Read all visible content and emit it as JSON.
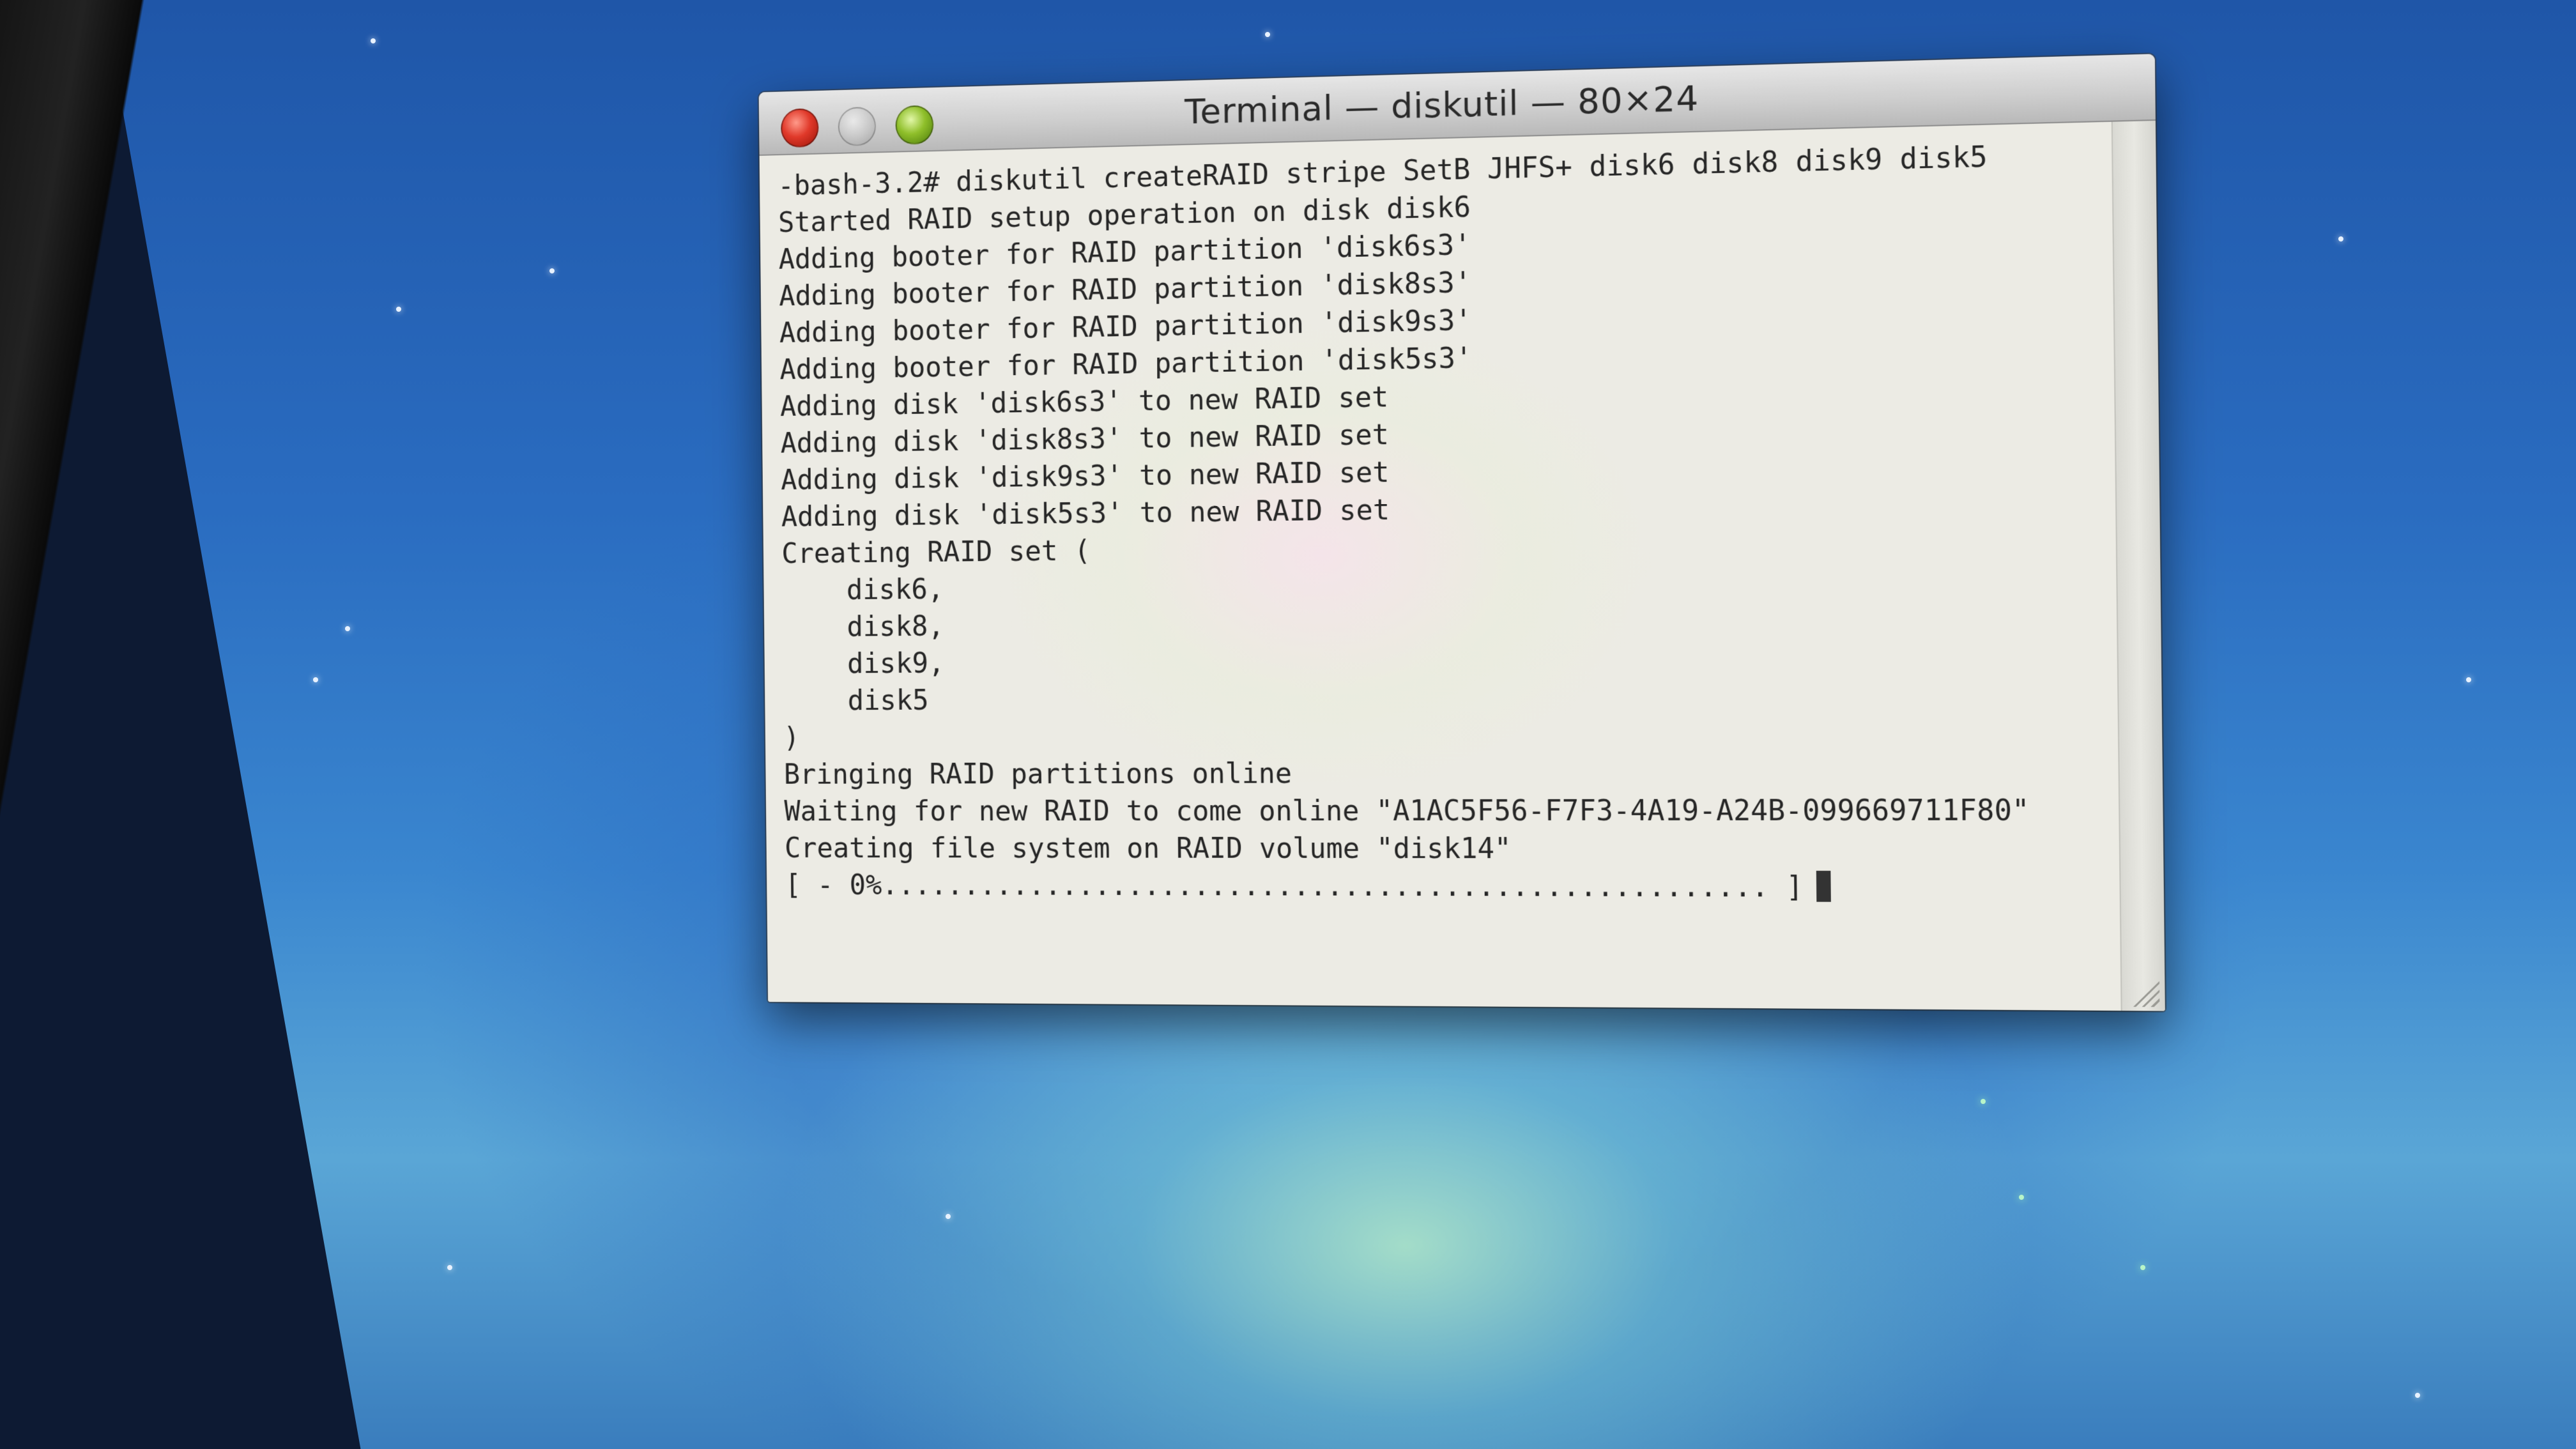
{
  "window": {
    "title": "Terminal — diskutil — 80×24"
  },
  "terminal": {
    "lines": [
      "-bash-3.2# diskutil createRAID stripe SetB JHFS+ disk6 disk8 disk9 disk5",
      "Started RAID setup operation on disk disk6",
      "Adding booter for RAID partition 'disk6s3'",
      "Adding booter for RAID partition 'disk8s3'",
      "Adding booter for RAID partition 'disk9s3'",
      "Adding booter for RAID partition 'disk5s3'",
      "Adding disk 'disk6s3' to new RAID set",
      "Adding disk 'disk8s3' to new RAID set",
      "Adding disk 'disk9s3' to new RAID set",
      "Adding disk 'disk5s3' to new RAID set",
      "Creating RAID set (",
      "    disk6,",
      "    disk8,",
      "    disk9,",
      "    disk5",
      ")",
      "Bringing RAID partitions online",
      "Waiting for new RAID to come online \"A1AC5F56-F7F3-4A19-A24B-099669711F80\"",
      "Creating file system on RAID volume \"disk14\"",
      "[ - 0%..................................................... ]"
    ]
  },
  "icons": {
    "close": "close-button-red",
    "minimize": "minimize-button-gray",
    "zoom": "zoom-button-green",
    "cursor": "text-cursor-block"
  }
}
